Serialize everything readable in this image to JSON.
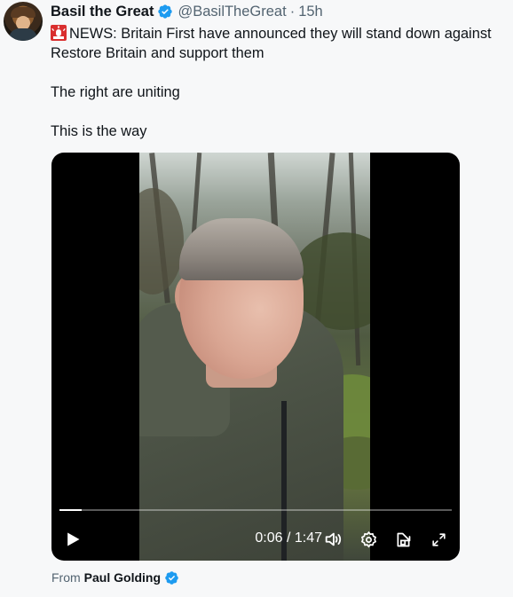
{
  "tweet": {
    "author_name": "Basil the Great",
    "author_handle": "@BasilTheGreat",
    "separator": "·",
    "time_ago": "15h",
    "verified_icon": "verified-badge-icon",
    "text_line_1": "NEWS: Britain First have announced they will stand down against Restore Britain and support them",
    "text_line_2": "The right are uniting",
    "text_line_3": "This is the way",
    "emoji": "police-light-icon"
  },
  "video": {
    "current_time": "0:06",
    "duration": "1:47",
    "time_separator": "/",
    "progress_fraction": 0.056,
    "controls": [
      "play-icon",
      "volume-icon",
      "settings-icon",
      "dock-icon",
      "fullscreen-icon"
    ]
  },
  "attribution": {
    "prefix": "From",
    "name": "Paul Golding"
  },
  "colors": {
    "verified": "#1d9bf0",
    "secondary_text": "#536471",
    "primary_text": "#0f1419",
    "background": "#f7f8f9"
  }
}
